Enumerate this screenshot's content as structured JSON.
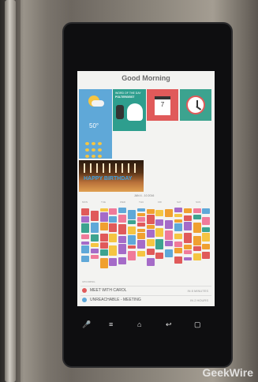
{
  "screen": {
    "greeting": "Good Morning",
    "weather": {
      "temperature": "50°"
    },
    "memo": {
      "title": "WORD OF THE DAY",
      "word": "POLTERGEIST"
    },
    "calendar_tile": {
      "day": "7"
    },
    "photo": {
      "caption": "HAPPY BIRTHDAY"
    },
    "calendar": {
      "date_range": "JAN 4 - 10 2016",
      "days": [
        "MON",
        "TUE",
        "WED",
        "THU",
        "FRI",
        "SAT",
        "SUN"
      ]
    },
    "schedule": {
      "label": "UPCOMING",
      "items": [
        {
          "title": "MEET WITH CAROL",
          "time": "IN 8 MINUTES",
          "color": "#e05a5a"
        },
        {
          "title": "UNREACHABLE - MEETING",
          "time": "IN 2 HOURS",
          "color": "#5fa8d8"
        }
      ]
    },
    "event_colors": [
      "#e05a5a",
      "#5fa8d8",
      "#f0a030",
      "#a56bc8",
      "#3ca38f",
      "#f07a9a",
      "#f5c542"
    ]
  },
  "navbar": {
    "icons": [
      "mic-icon",
      "menu-icon",
      "home-icon",
      "back-icon",
      "apps-icon"
    ]
  },
  "watermark": "GeekWire"
}
